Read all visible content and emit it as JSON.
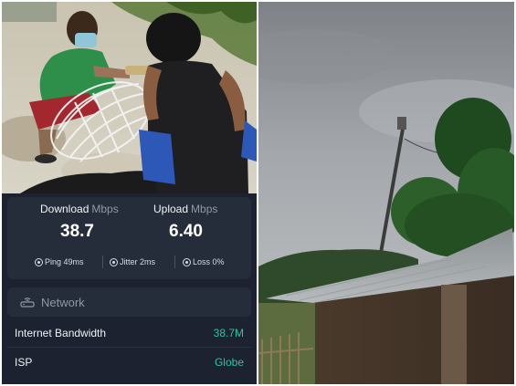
{
  "speedtest": {
    "download": {
      "label": "Download",
      "unit": "Mbps",
      "value": "38.7"
    },
    "upload": {
      "label": "Upload",
      "unit": "Mbps",
      "value": "6.40"
    },
    "ping": "Ping 49ms",
    "jitter": "Jitter 2ms",
    "loss": "Loss 0%"
  },
  "network": {
    "title": "Network",
    "rows": [
      {
        "label": "Internet Bandwidth",
        "value": "38.7M"
      },
      {
        "label": "ISP",
        "value": "Globe"
      }
    ]
  },
  "colors": {
    "panel_bg": "#1c2230",
    "card_bg": "#252c3a",
    "accent_green": "#2ec4a2",
    "muted_text": "#8f98a8"
  },
  "icons": {
    "network": "router-icon",
    "ping": "ping-icon",
    "jitter": "jitter-icon",
    "loss": "loss-icon"
  }
}
